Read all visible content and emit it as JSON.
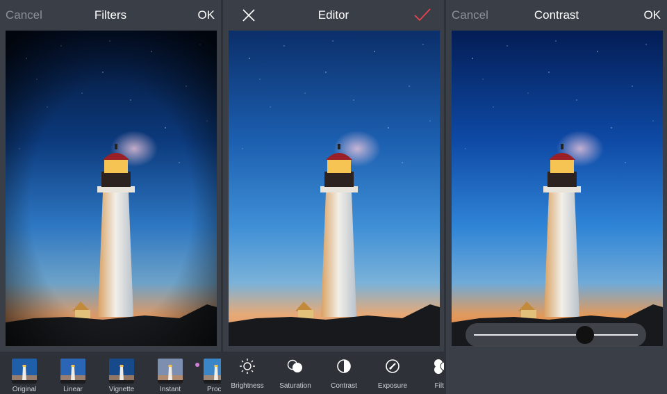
{
  "filters_panel": {
    "cancel_label": "Cancel",
    "title": "Filters",
    "ok_label": "OK",
    "filters": [
      {
        "label": "Original",
        "icon": "lighthouse-thumbnail"
      },
      {
        "label": "Linear",
        "icon": "lighthouse-thumbnail"
      },
      {
        "label": "Vignette",
        "icon": "lighthouse-thumbnail"
      },
      {
        "label": "Instant",
        "icon": "lighthouse-thumbnail"
      },
      {
        "label": "Proce",
        "icon": "lighthouse-thumbnail"
      }
    ],
    "selection_dot_color": "#d07fd6"
  },
  "editor_panel": {
    "close_icon": "close-icon",
    "title": "Editor",
    "confirm_icon": "checkmark-icon",
    "confirm_color": "#e8434e",
    "tools": [
      {
        "label": "Brightness",
        "icon": "sun-icon"
      },
      {
        "label": "Saturation",
        "icon": "saturation-icon"
      },
      {
        "label": "Contrast",
        "icon": "contrast-icon"
      },
      {
        "label": "Exposure",
        "icon": "exposure-icon"
      },
      {
        "label": "Filte",
        "icon": "filters-icon"
      }
    ]
  },
  "contrast_panel": {
    "cancel_label": "Cancel",
    "title": "Contrast",
    "ok_label": "OK",
    "slider_value_fraction": 0.68
  },
  "colors": {
    "topbar_bg": "#3a3f47",
    "bottom_bg": "#2e3238",
    "muted_text": "#8c9096"
  }
}
